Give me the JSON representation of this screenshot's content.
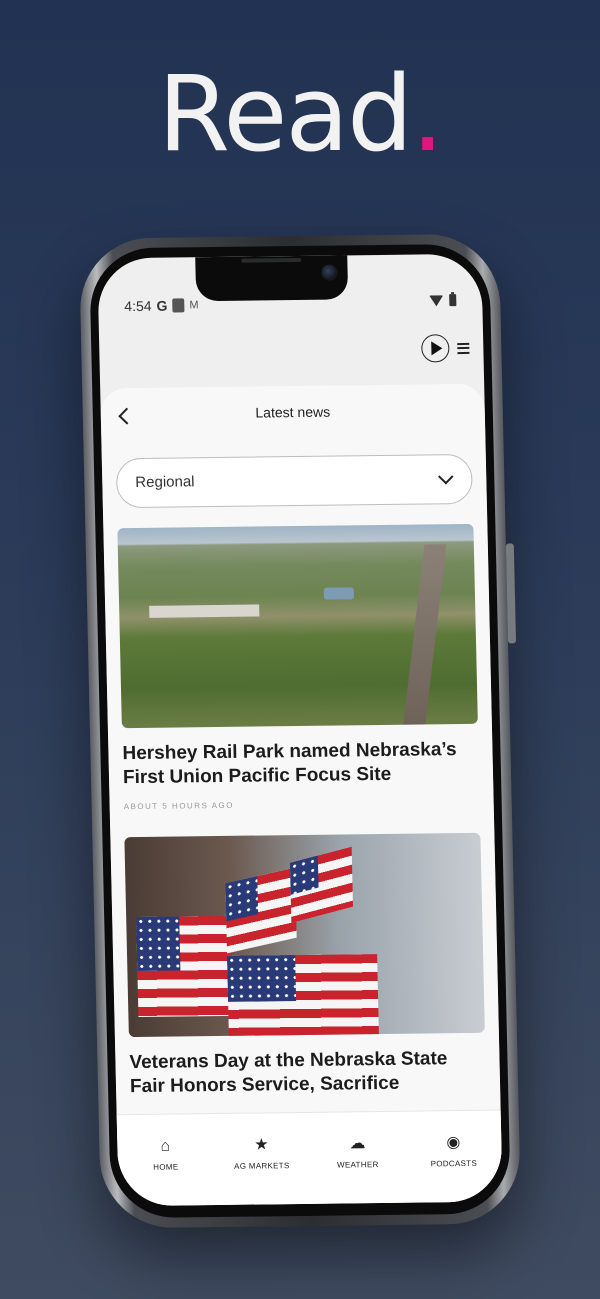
{
  "headline": {
    "text": "Read",
    "dot": "."
  },
  "status_bar": {
    "time": "4:54",
    "g": "G",
    "m": "M"
  },
  "screen": {
    "title": "Latest news",
    "filter": {
      "selected": "Regional"
    }
  },
  "articles": [
    {
      "title": "Hershey Rail Park named Nebraska’s First Union Pacific Focus Site",
      "time": "ABOUT 5 HOURS AGO",
      "image": "aerial-farmland-rail-photo"
    },
    {
      "title": "Veterans Day at the Nebraska State Fair Honors Service, Sacrifice",
      "time": "",
      "image": "american-flags-parade-photo"
    }
  ],
  "tabs": [
    {
      "label": "HOME",
      "icon": "home-icon"
    },
    {
      "label": "AG MARKETS",
      "icon": "star-icon"
    },
    {
      "label": "WEATHER",
      "icon": "weather-icon"
    },
    {
      "label": "PODCASTS",
      "icon": "podcast-icon"
    }
  ],
  "colors": {
    "accent_dot": "#e3157f",
    "background_top": "#223252",
    "background_bottom": "#3f4b60"
  }
}
